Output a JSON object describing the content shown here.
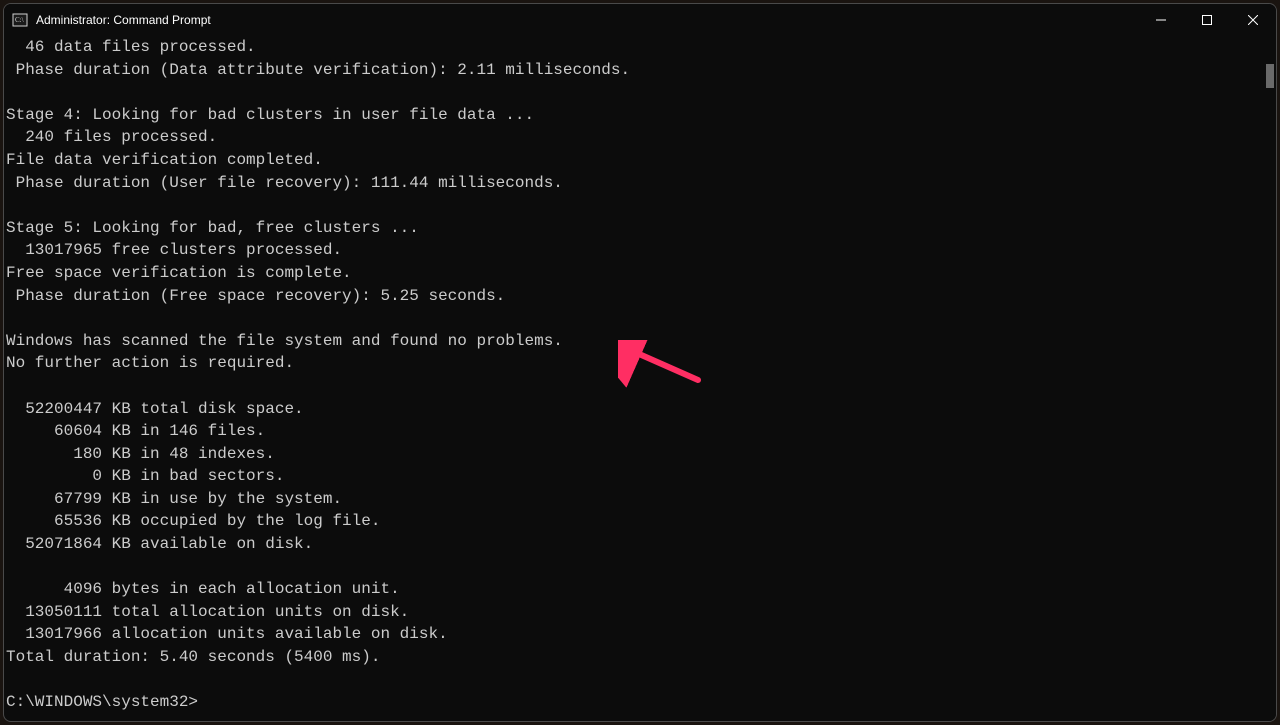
{
  "window": {
    "title": "Administrator: Command Prompt"
  },
  "terminal": {
    "lines": [
      "  46 data files processed.",
      " Phase duration (Data attribute verification): 2.11 milliseconds.",
      "",
      "Stage 4: Looking for bad clusters in user file data ...",
      "  240 files processed.",
      "File data verification completed.",
      " Phase duration (User file recovery): 111.44 milliseconds.",
      "",
      "Stage 5: Looking for bad, free clusters ...",
      "  13017965 free clusters processed.",
      "Free space verification is complete.",
      " Phase duration (Free space recovery): 5.25 seconds.",
      "",
      "Windows has scanned the file system and found no problems.",
      "No further action is required.",
      "",
      "  52200447 KB total disk space.",
      "     60604 KB in 146 files.",
      "       180 KB in 48 indexes.",
      "         0 KB in bad sectors.",
      "     67799 KB in use by the system.",
      "     65536 KB occupied by the log file.",
      "  52071864 KB available on disk.",
      "",
      "      4096 bytes in each allocation unit.",
      "  13050111 total allocation units on disk.",
      "  13017966 allocation units available on disk.",
      "Total duration: 5.40 seconds (5400 ms).",
      "",
      "C:\\WINDOWS\\system32>"
    ]
  },
  "annotation": {
    "arrow_color": "#ff2e63"
  }
}
